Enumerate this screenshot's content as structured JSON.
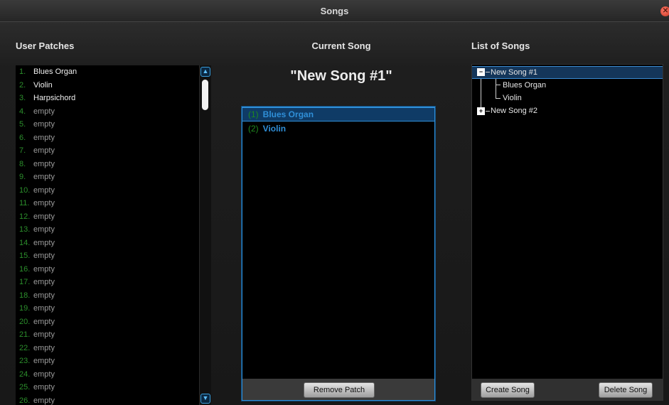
{
  "window": {
    "title": "Songs",
    "close_icon": "close-icon"
  },
  "user_patches": {
    "heading": "User Patches",
    "items": [
      {
        "num": "1.",
        "name": "Blues Organ",
        "empty": false
      },
      {
        "num": "2.",
        "name": "Violin",
        "empty": false
      },
      {
        "num": "3.",
        "name": "Harpsichord",
        "empty": false
      },
      {
        "num": "4.",
        "name": "empty",
        "empty": true
      },
      {
        "num": "5.",
        "name": "empty",
        "empty": true
      },
      {
        "num": "6.",
        "name": "empty",
        "empty": true
      },
      {
        "num": "7.",
        "name": "empty",
        "empty": true
      },
      {
        "num": "8.",
        "name": "empty",
        "empty": true
      },
      {
        "num": "9.",
        "name": "empty",
        "empty": true
      },
      {
        "num": "10.",
        "name": "empty",
        "empty": true
      },
      {
        "num": "11.",
        "name": "empty",
        "empty": true
      },
      {
        "num": "12.",
        "name": "empty",
        "empty": true
      },
      {
        "num": "13.",
        "name": "empty",
        "empty": true
      },
      {
        "num": "14.",
        "name": "empty",
        "empty": true
      },
      {
        "num": "15.",
        "name": "empty",
        "empty": true
      },
      {
        "num": "16.",
        "name": "empty",
        "empty": true
      },
      {
        "num": "17.",
        "name": "empty",
        "empty": true
      },
      {
        "num": "18.",
        "name": "empty",
        "empty": true
      },
      {
        "num": "19.",
        "name": "empty",
        "empty": true
      },
      {
        "num": "20.",
        "name": "empty",
        "empty": true
      },
      {
        "num": "21.",
        "name": "empty",
        "empty": true
      },
      {
        "num": "22.",
        "name": "empty",
        "empty": true
      },
      {
        "num": "23.",
        "name": "empty",
        "empty": true
      },
      {
        "num": "24.",
        "name": "empty",
        "empty": true
      },
      {
        "num": "25.",
        "name": "empty",
        "empty": true
      },
      {
        "num": "26.",
        "name": "empty",
        "empty": true
      }
    ]
  },
  "current_song": {
    "heading": "Current Song",
    "name": "\"New Song #1\"",
    "patches": [
      {
        "num": "(1)",
        "name": "Blues Organ",
        "selected": true
      },
      {
        "num": "(2)",
        "name": "Violin",
        "selected": false
      }
    ],
    "remove_button": "Remove Patch"
  },
  "song_list": {
    "heading": "List of Songs",
    "songs": [
      {
        "name": "New Song #1",
        "expanded": true,
        "selected": true,
        "children": [
          "Blues Organ",
          "Violin"
        ]
      },
      {
        "name": "New Song #2",
        "expanded": false,
        "selected": false,
        "children": []
      }
    ],
    "create_button": "Create Song",
    "delete_button": "Delete Song"
  },
  "colors": {
    "accent_blue": "#2f8fd8",
    "number_green": "#2c8f2c",
    "empty_gray": "#9a9a9a"
  }
}
